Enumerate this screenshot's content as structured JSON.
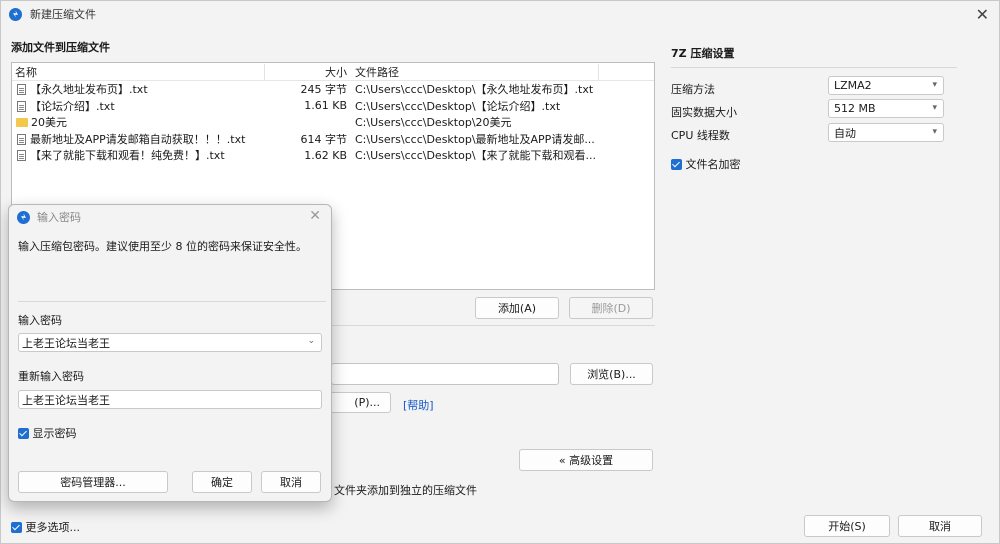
{
  "window": {
    "title": "新建压缩文件",
    "close": "✕"
  },
  "main": {
    "section_title": "添加文件到压缩文件",
    "columns": {
      "name": "名称",
      "size": "大小",
      "path": "文件路径"
    },
    "files": [
      {
        "name": "【永久地址发布页】.txt",
        "size": "245 字节",
        "path": "C:\\Users\\ccc\\Desktop\\【永久地址发布页】.txt",
        "icon": "file-icon"
      },
      {
        "name": "【论坛介绍】.txt",
        "size": "1.61 KB",
        "path": "C:\\Users\\ccc\\Desktop\\【论坛介绍】.txt",
        "icon": "file-icon"
      },
      {
        "name": "20美元",
        "size": "",
        "path": "C:\\Users\\ccc\\Desktop\\20美元",
        "icon": "folder-icon"
      },
      {
        "name": "最新地址及APP请发邮箱自动获取！！！.txt",
        "size": "614 字节",
        "path": "C:\\Users\\ccc\\Desktop\\最新地址及APP请发邮...",
        "icon": "file-icon"
      },
      {
        "name": "【来了就能下载和观看！纯免费！】.txt",
        "size": "1.62 KB",
        "path": "C:\\Users\\ccc\\Desktop\\【来了就能下载和观看...",
        "icon": "file-icon"
      }
    ],
    "add_button": "添加(A)",
    "delete_button": "删除(D)",
    "browse_button": "浏览(B)...",
    "partial_button": "(P)...",
    "help_link": "[帮助]",
    "advanced_button": "« 高级设置",
    "partial_checkbox_text": "文件夹添加到独立的压缩文件",
    "more_options": "更多选项...",
    "start_button": "开始(S)",
    "cancel_button": "取消"
  },
  "settings": {
    "title": "7Z 压缩设置",
    "method_label": "压缩方法",
    "method_value": "LZMA2",
    "dict_label": "固实数据大小",
    "dict_value": "512 MB",
    "threads_label": "CPU 线程数",
    "threads_value": "自动",
    "encrypt_names_label": "文件名加密"
  },
  "dialog": {
    "title": "输入密码",
    "description": "输入压缩包密码。建议使用至少 8 位的密码来保证安全性。",
    "password_label": "输入密码",
    "password_value": "上老王论坛当老王",
    "repeat_label": "重新输入密码",
    "repeat_value": "上老王论坛当老王",
    "show_password": "显示密码",
    "manager_button": "密码管理器...",
    "ok_button": "确定",
    "cancel_button": "取消"
  },
  "colors": {
    "accent": "#1e6fd1",
    "link": "#1457c9"
  }
}
